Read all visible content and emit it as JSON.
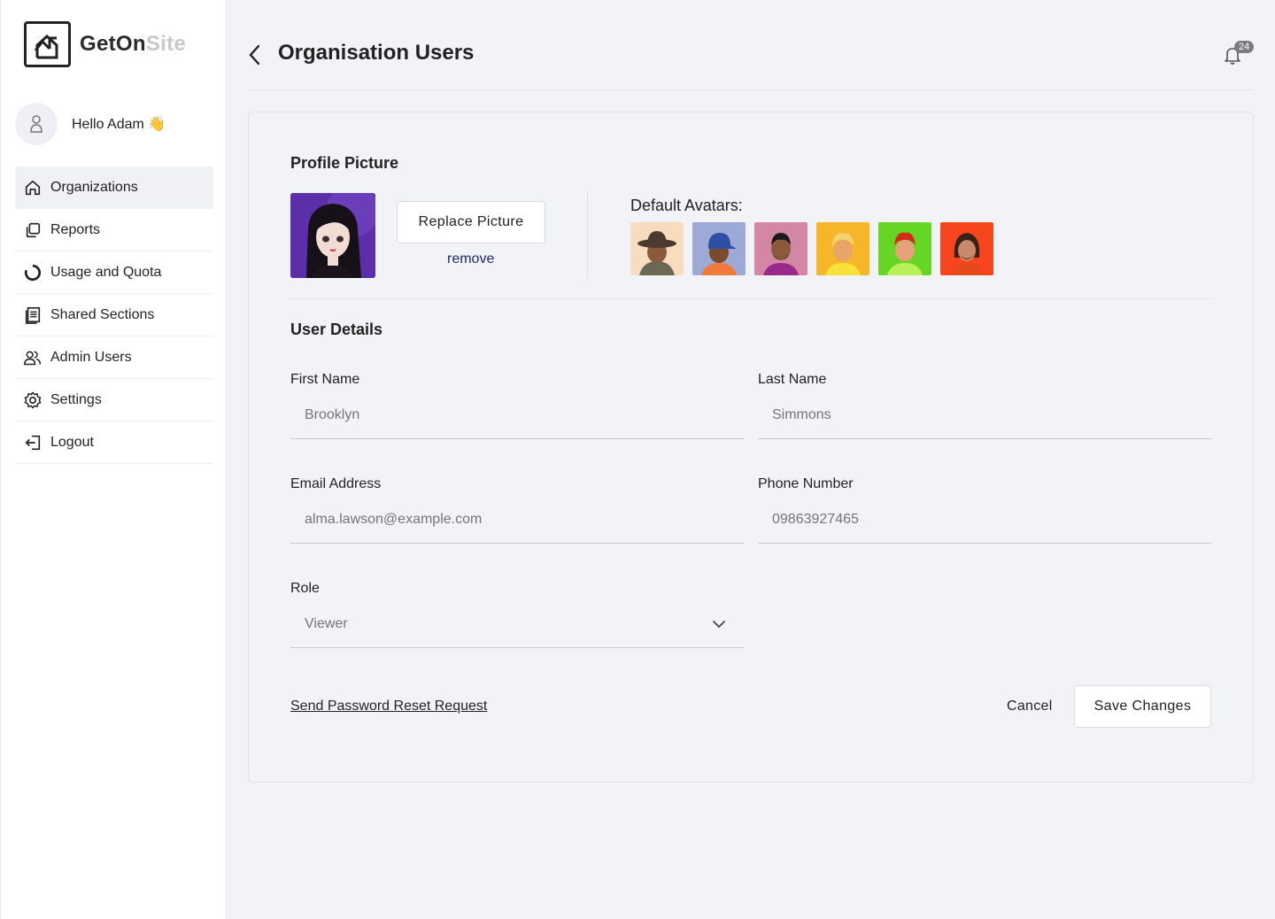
{
  "brand": {
    "name_primary": "GetOn",
    "name_secondary": "Site"
  },
  "user": {
    "greeting": "Hello Adam",
    "wave": "👋"
  },
  "sidebar": {
    "items": [
      {
        "label": "Organizations",
        "icon": "home-icon",
        "active": true
      },
      {
        "label": "Reports",
        "icon": "copy-icon"
      },
      {
        "label": "Usage and Quota",
        "icon": "pie-icon"
      },
      {
        "label": "Shared Sections",
        "icon": "document-icon"
      },
      {
        "label": "Admin Users",
        "icon": "users-icon"
      },
      {
        "label": "Settings",
        "icon": "gear-icon"
      },
      {
        "label": "Logout",
        "icon": "logout-icon"
      }
    ]
  },
  "header": {
    "title": "Organisation Users",
    "notification_count": "24"
  },
  "profile": {
    "title": "Profile Picture",
    "replace_label": "Replace Picture",
    "remove_label": "remove",
    "default_avatars_label": "Default Avatars:",
    "avatar_colors": [
      "#f8dcc0",
      "#9da9d6",
      "#d487a4",
      "#f6b62a",
      "#64d623",
      "#f7461d"
    ]
  },
  "details": {
    "title": "User Details",
    "first_name": {
      "label": "First Name",
      "value": "Brooklyn"
    },
    "last_name": {
      "label": "Last Name",
      "value": "Simmons"
    },
    "email": {
      "label": "Email Address",
      "value": "alma.lawson@example.com"
    },
    "phone": {
      "label": "Phone Number",
      "value": "09863927465"
    },
    "role": {
      "label": "Role",
      "value": "Viewer"
    }
  },
  "actions": {
    "reset_label": "Send Password Reset Request",
    "cancel_label": "Cancel",
    "save_label": "Save Changes"
  }
}
